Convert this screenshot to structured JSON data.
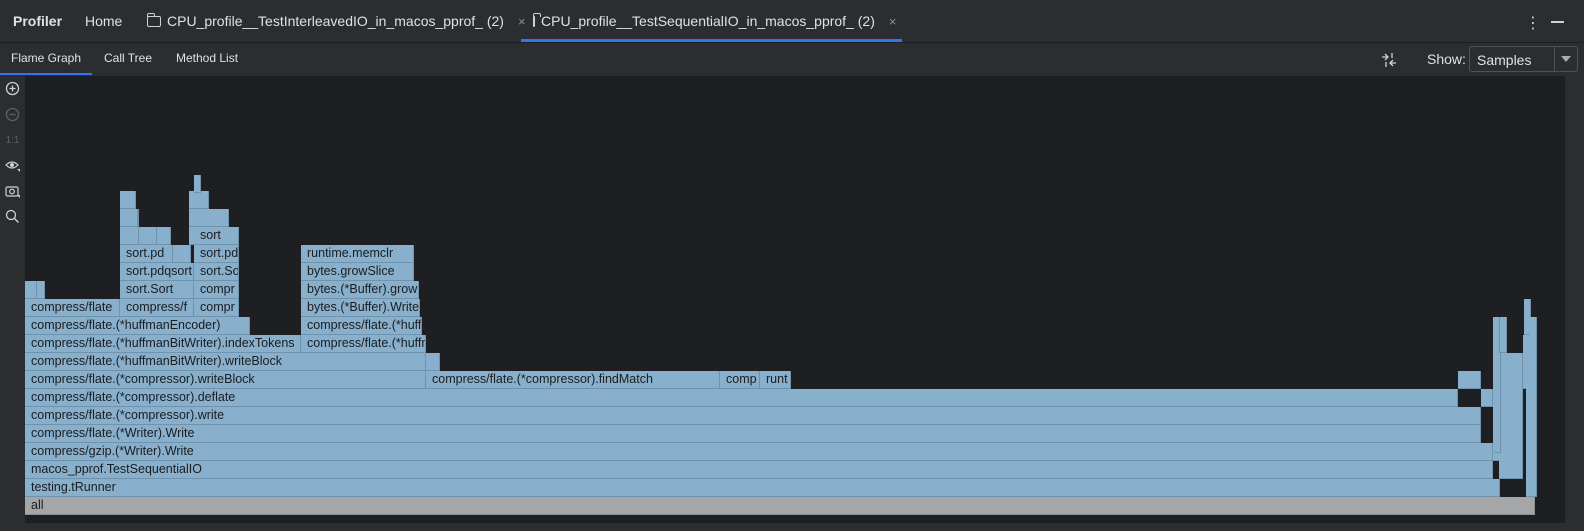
{
  "app": {
    "title": "Profiler"
  },
  "tabs": [
    {
      "label": "Home",
      "closable": false,
      "active": false
    },
    {
      "label": "CPU_profile__TestInterleavedIO_in_macos_pprof_ (2)",
      "closable": true,
      "active": false
    },
    {
      "label": "CPU_profile__TestSequentialIO_in_macos_pprof_ (2)",
      "closable": true,
      "active": true
    }
  ],
  "close_glyph": "×",
  "subtabs": [
    {
      "label": "Flame Graph",
      "active": true
    },
    {
      "label": "Call Tree",
      "active": false
    },
    {
      "label": "Method List",
      "active": false
    }
  ],
  "show": {
    "label": "Show:",
    "value": "Samples"
  },
  "toolbar_icons": [
    "zoom-in-icon",
    "zoom-out-icon",
    "actual-size-icon",
    "eye-icon",
    "camera-icon",
    "search-icon"
  ],
  "actual_size_label": "1:1",
  "colors": {
    "accent": "#3574f0",
    "frame": "#88afcb",
    "root_frame": "#a5a6a8",
    "canvas": "#1e1f22"
  },
  "flame": {
    "root": "all",
    "frames": [
      {
        "label": "testing.tRunner"
      },
      {
        "label": "macos_pprof.TestSequentialIO"
      },
      {
        "label": "compress/gzip.(*Writer).Write"
      },
      {
        "label": "compress/flate.(*Writer).Write"
      },
      {
        "label": "compress/flate.(*compressor).write"
      },
      {
        "label": "compress/flate.(*compressor).deflate"
      },
      {
        "label": "compress/flate.(*compressor).writeBlock"
      },
      {
        "label": "compress/flate.(*compressor).findMatch"
      },
      {
        "label": "comp"
      },
      {
        "label": "runt"
      },
      {
        "label": "compress/flate.(*huffmanBitWriter).writeBlock"
      },
      {
        "label": "compress/flate.(*huffmanBitWriter).indexTokens"
      },
      {
        "label": "compress/flate.(*huffmanEncoder)"
      },
      {
        "label": "compress/flate"
      },
      {
        "label": "compress/f"
      },
      {
        "label": "compr"
      },
      {
        "label": "compr"
      },
      {
        "label": "sort.Sort"
      },
      {
        "label": "sort.pdqsort"
      },
      {
        "label": "sort.pd"
      },
      {
        "label": "sort.Sort"
      },
      {
        "label": "sort.pd"
      },
      {
        "label": "sort"
      },
      {
        "label": "compress/flate.(*huffmanBitWriter)"
      },
      {
        "label": "compress/flate.(*huffmanBitWriter)"
      },
      {
        "label": "bytes.(*Buffer).Write"
      },
      {
        "label": "bytes.(*Buffer).grow"
      },
      {
        "label": "bytes.growSlice"
      },
      {
        "label": "runtime.memclr"
      }
    ]
  }
}
